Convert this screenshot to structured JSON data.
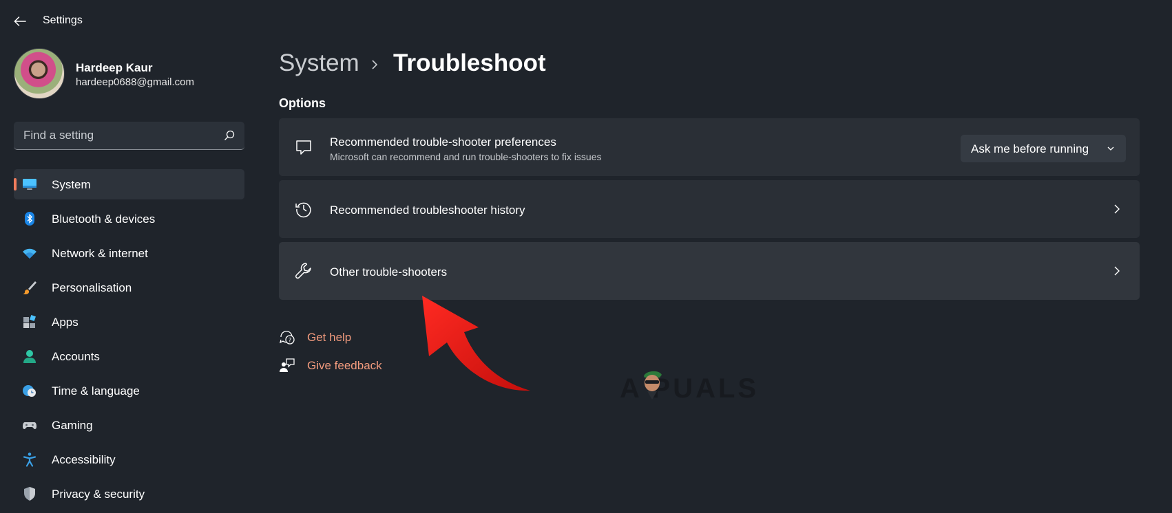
{
  "window": {
    "title": "Settings"
  },
  "profile": {
    "name": "Hardeep Kaur",
    "email": "hardeep0688@gmail.com"
  },
  "search": {
    "placeholder": "Find a setting"
  },
  "sidebar": {
    "items": [
      {
        "label": "System",
        "icon": "monitor-icon",
        "active": true
      },
      {
        "label": "Bluetooth & devices",
        "icon": "bluetooth-icon"
      },
      {
        "label": "Network & internet",
        "icon": "wifi-icon"
      },
      {
        "label": "Personalisation",
        "icon": "paintbrush-icon"
      },
      {
        "label": "Apps",
        "icon": "apps-icon"
      },
      {
        "label": "Accounts",
        "icon": "person-icon"
      },
      {
        "label": "Time & language",
        "icon": "globe-clock-icon"
      },
      {
        "label": "Gaming",
        "icon": "gamepad-icon"
      },
      {
        "label": "Accessibility",
        "icon": "accessibility-icon"
      },
      {
        "label": "Privacy & security",
        "icon": "shield-icon"
      }
    ]
  },
  "breadcrumb": {
    "parent": "System",
    "current": "Troubleshoot"
  },
  "options": {
    "title": "Options",
    "cards": [
      {
        "title": "Recommended trouble-shooter preferences",
        "subtitle": "Microsoft can recommend and run trouble-shooters to fix issues",
        "icon": "chat-bubble-icon",
        "dropdown_value": "Ask me before running"
      },
      {
        "title": "Recommended troubleshooter history",
        "icon": "history-icon"
      },
      {
        "title": "Other trouble-shooters",
        "icon": "wrench-icon"
      }
    ]
  },
  "links": {
    "get_help": "Get help",
    "give_feedback": "Give feedback"
  },
  "watermark": {
    "text": "A PUALS"
  },
  "colors": {
    "accent": "#f07c5c",
    "link": "#f29b7e",
    "arrow": "#e3201b"
  }
}
